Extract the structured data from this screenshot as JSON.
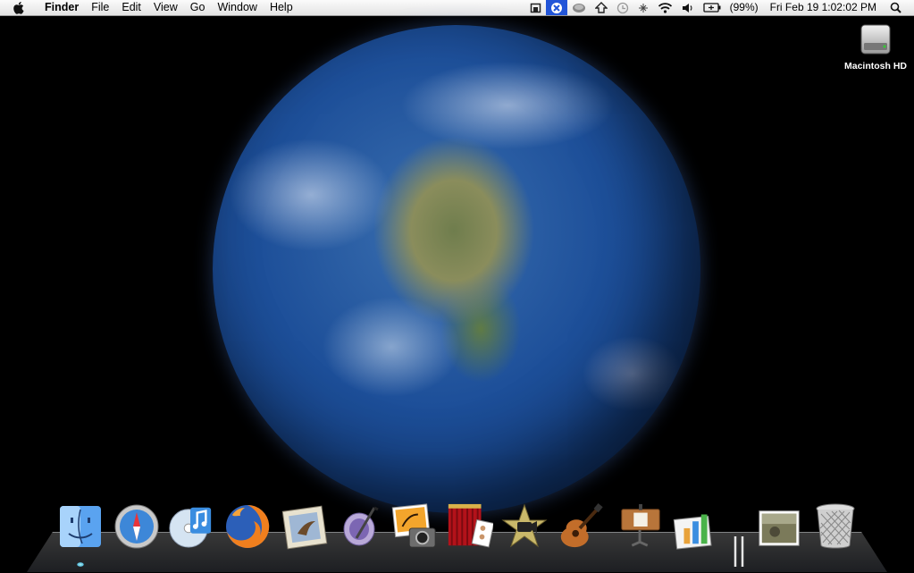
{
  "menubar": {
    "app_name": "Finder",
    "menus": [
      "File",
      "Edit",
      "View",
      "Go",
      "Window",
      "Help"
    ],
    "battery": "(99%)",
    "clock": "Fri Feb 19  1:02:02 PM",
    "status_icons": [
      "front-row-icon",
      "menu-extra-icon",
      "sync-icon",
      "time-machine-icon",
      "time-machine-clock-icon",
      "bluetooth-icon",
      "wifi-icon",
      "volume-icon",
      "battery-icon",
      "spotlight-icon"
    ]
  },
  "desktop": {
    "hd_label": "Macintosh HD"
  },
  "dock": {
    "items": [
      "Finder",
      "Safari",
      "iTunes",
      "Firefox",
      "Mail",
      "iChat",
      "iPhoto",
      "Photo Booth",
      "iMovie",
      "GarageBand",
      "Keynote",
      "Numbers",
      "Stack",
      "Trash"
    ]
  },
  "colors": {
    "menubar_bg": "#f0f0f0",
    "active_status": "#2255d8",
    "desktop_bg": "#000000"
  }
}
